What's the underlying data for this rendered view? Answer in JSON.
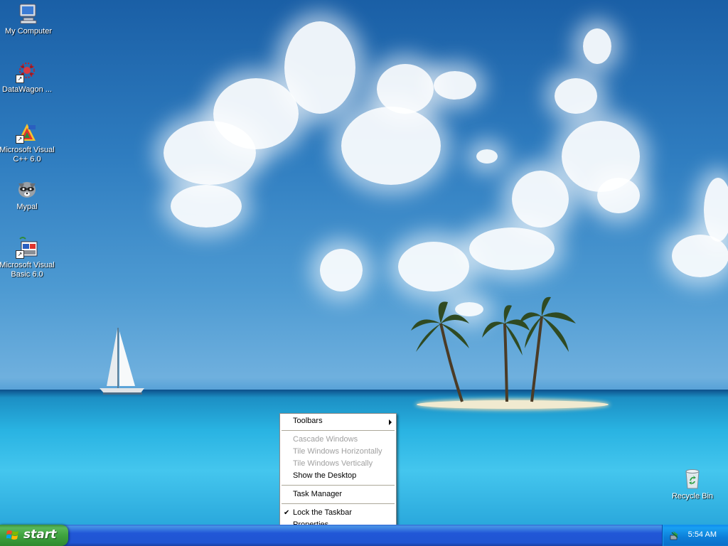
{
  "desktop": {
    "icons": [
      {
        "label": "My Computer",
        "icon": "my-computer-icon"
      },
      {
        "label": "DataWagon ...",
        "icon": "datawagon-icon"
      },
      {
        "label": "Microsoft Visual C++ 6.0",
        "icon": "visual-cpp-icon"
      },
      {
        "label": "Mypal",
        "icon": "mypal-icon"
      },
      {
        "label": "Microsoft Visual Basic 6.0",
        "icon": "visual-basic-icon"
      },
      {
        "label": "Recycle Bin",
        "icon": "recycle-bin-icon"
      }
    ]
  },
  "context_menu": {
    "items": [
      {
        "label": "Toolbars",
        "submenu": true
      },
      {
        "label": "Cascade Windows",
        "disabled": true
      },
      {
        "label": "Tile Windows Horizontally",
        "disabled": true
      },
      {
        "label": "Tile Windows Vertically",
        "disabled": true
      },
      {
        "label": "Show the Desktop"
      },
      {
        "label": "Task Manager"
      },
      {
        "label": "Lock the Taskbar",
        "checked": true
      },
      {
        "label": "Properties"
      }
    ]
  },
  "taskbar": {
    "start_label": "start",
    "clock": "5:54 AM",
    "tray_icon": "safely-remove-hardware-icon"
  },
  "colors": {
    "taskbar_blue": "#2157d7",
    "start_green": "#3fa33f",
    "tray_blue": "#0f8bed",
    "menu_disabled": "#a0a0a0"
  }
}
